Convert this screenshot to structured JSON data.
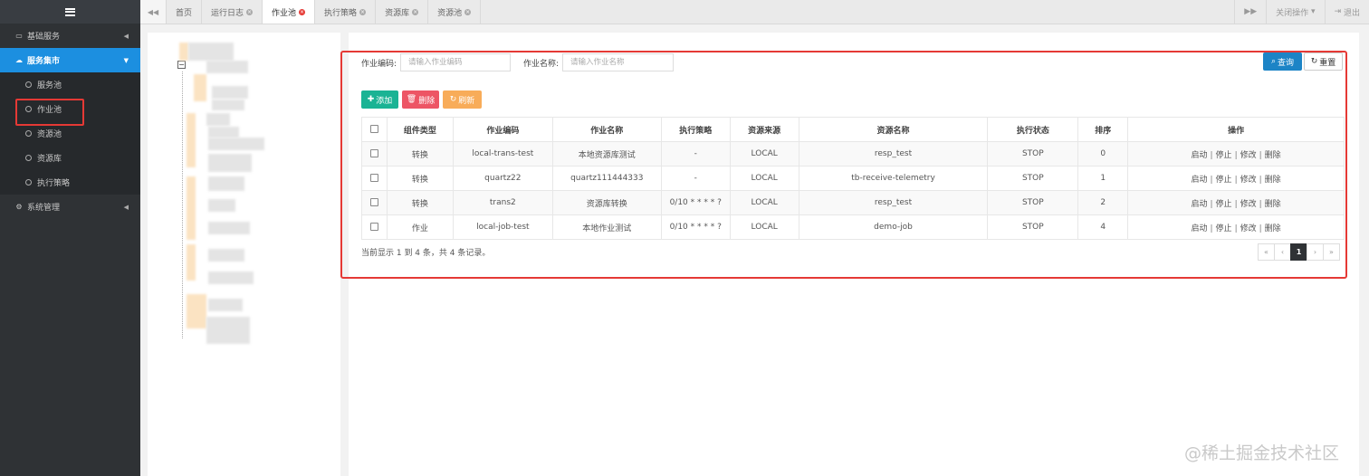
{
  "sidebar": {
    "groups": [
      {
        "label": "基础服务",
        "icon": "laptop-icon",
        "active": false
      },
      {
        "label": "服务集市",
        "icon": "cloud-icon",
        "active": true
      },
      {
        "label": "系统管理",
        "icon": "gears-icon",
        "active": false
      }
    ],
    "sub_items": [
      {
        "label": "服务池"
      },
      {
        "label": "作业池"
      },
      {
        "label": "资源池"
      },
      {
        "label": "资源库"
      },
      {
        "label": "执行策略"
      }
    ]
  },
  "tabs": [
    {
      "label": "首页",
      "closable": false
    },
    {
      "label": "运行日志",
      "closable": true
    },
    {
      "label": "作业池",
      "closable": true,
      "current": true
    },
    {
      "label": "执行策略",
      "closable": true
    },
    {
      "label": "资源库",
      "closable": true
    },
    {
      "label": "资源池",
      "closable": true
    }
  ],
  "tabbar_right": {
    "close_ops_label": "关闭操作",
    "logout_label": "退出"
  },
  "search": {
    "code_label": "作业编码:",
    "code_placeholder": "请输入作业编码",
    "name_label": "作业名称:",
    "name_placeholder": "请输入作业名称",
    "query_label": "查询",
    "reset_label": "重置"
  },
  "toolbar": {
    "add_label": "添加",
    "delete_label": "删除",
    "refresh_label": "刷新"
  },
  "table": {
    "columns": [
      "组件类型",
      "作业编码",
      "作业名称",
      "执行策略",
      "资源来源",
      "资源名称",
      "执行状态",
      "排序",
      "操作"
    ],
    "rows": [
      [
        "转换",
        "local-trans-test",
        "本地资源库测试",
        "-",
        "LOCAL",
        "resp_test",
        "STOP",
        "0"
      ],
      [
        "转换",
        "quartz22",
        "quartz111444333",
        "-",
        "LOCAL",
        "tb-receive-telemetry",
        "STOP",
        "1"
      ],
      [
        "转换",
        "trans2",
        "资源库转换",
        "0/10 * * * * ?",
        "LOCAL",
        "resp_test",
        "STOP",
        "2"
      ],
      [
        "作业",
        "local-job-test",
        "本地作业测试",
        "0/10 * * * * ?",
        "LOCAL",
        "demo-job",
        "STOP",
        "4"
      ]
    ],
    "actions": [
      "启动",
      "停止",
      "修改",
      "删除"
    ]
  },
  "footer": {
    "summary": "当前显示 1 到 4 条，共 4 条记录。",
    "pager": [
      "«",
      "‹",
      "1",
      "›",
      "»"
    ],
    "current_page": "1"
  },
  "watermark": "@稀土掘金技术社区",
  "colors": {
    "sidebar_bg": "#2f3235",
    "sidebar_active": "#1c8fe0",
    "highlight_red": "#e53935",
    "btn_query": "#1c84c6",
    "btn_add": "#1ab394",
    "btn_delete": "#ed5565",
    "btn_refresh": "#f8ac59"
  }
}
